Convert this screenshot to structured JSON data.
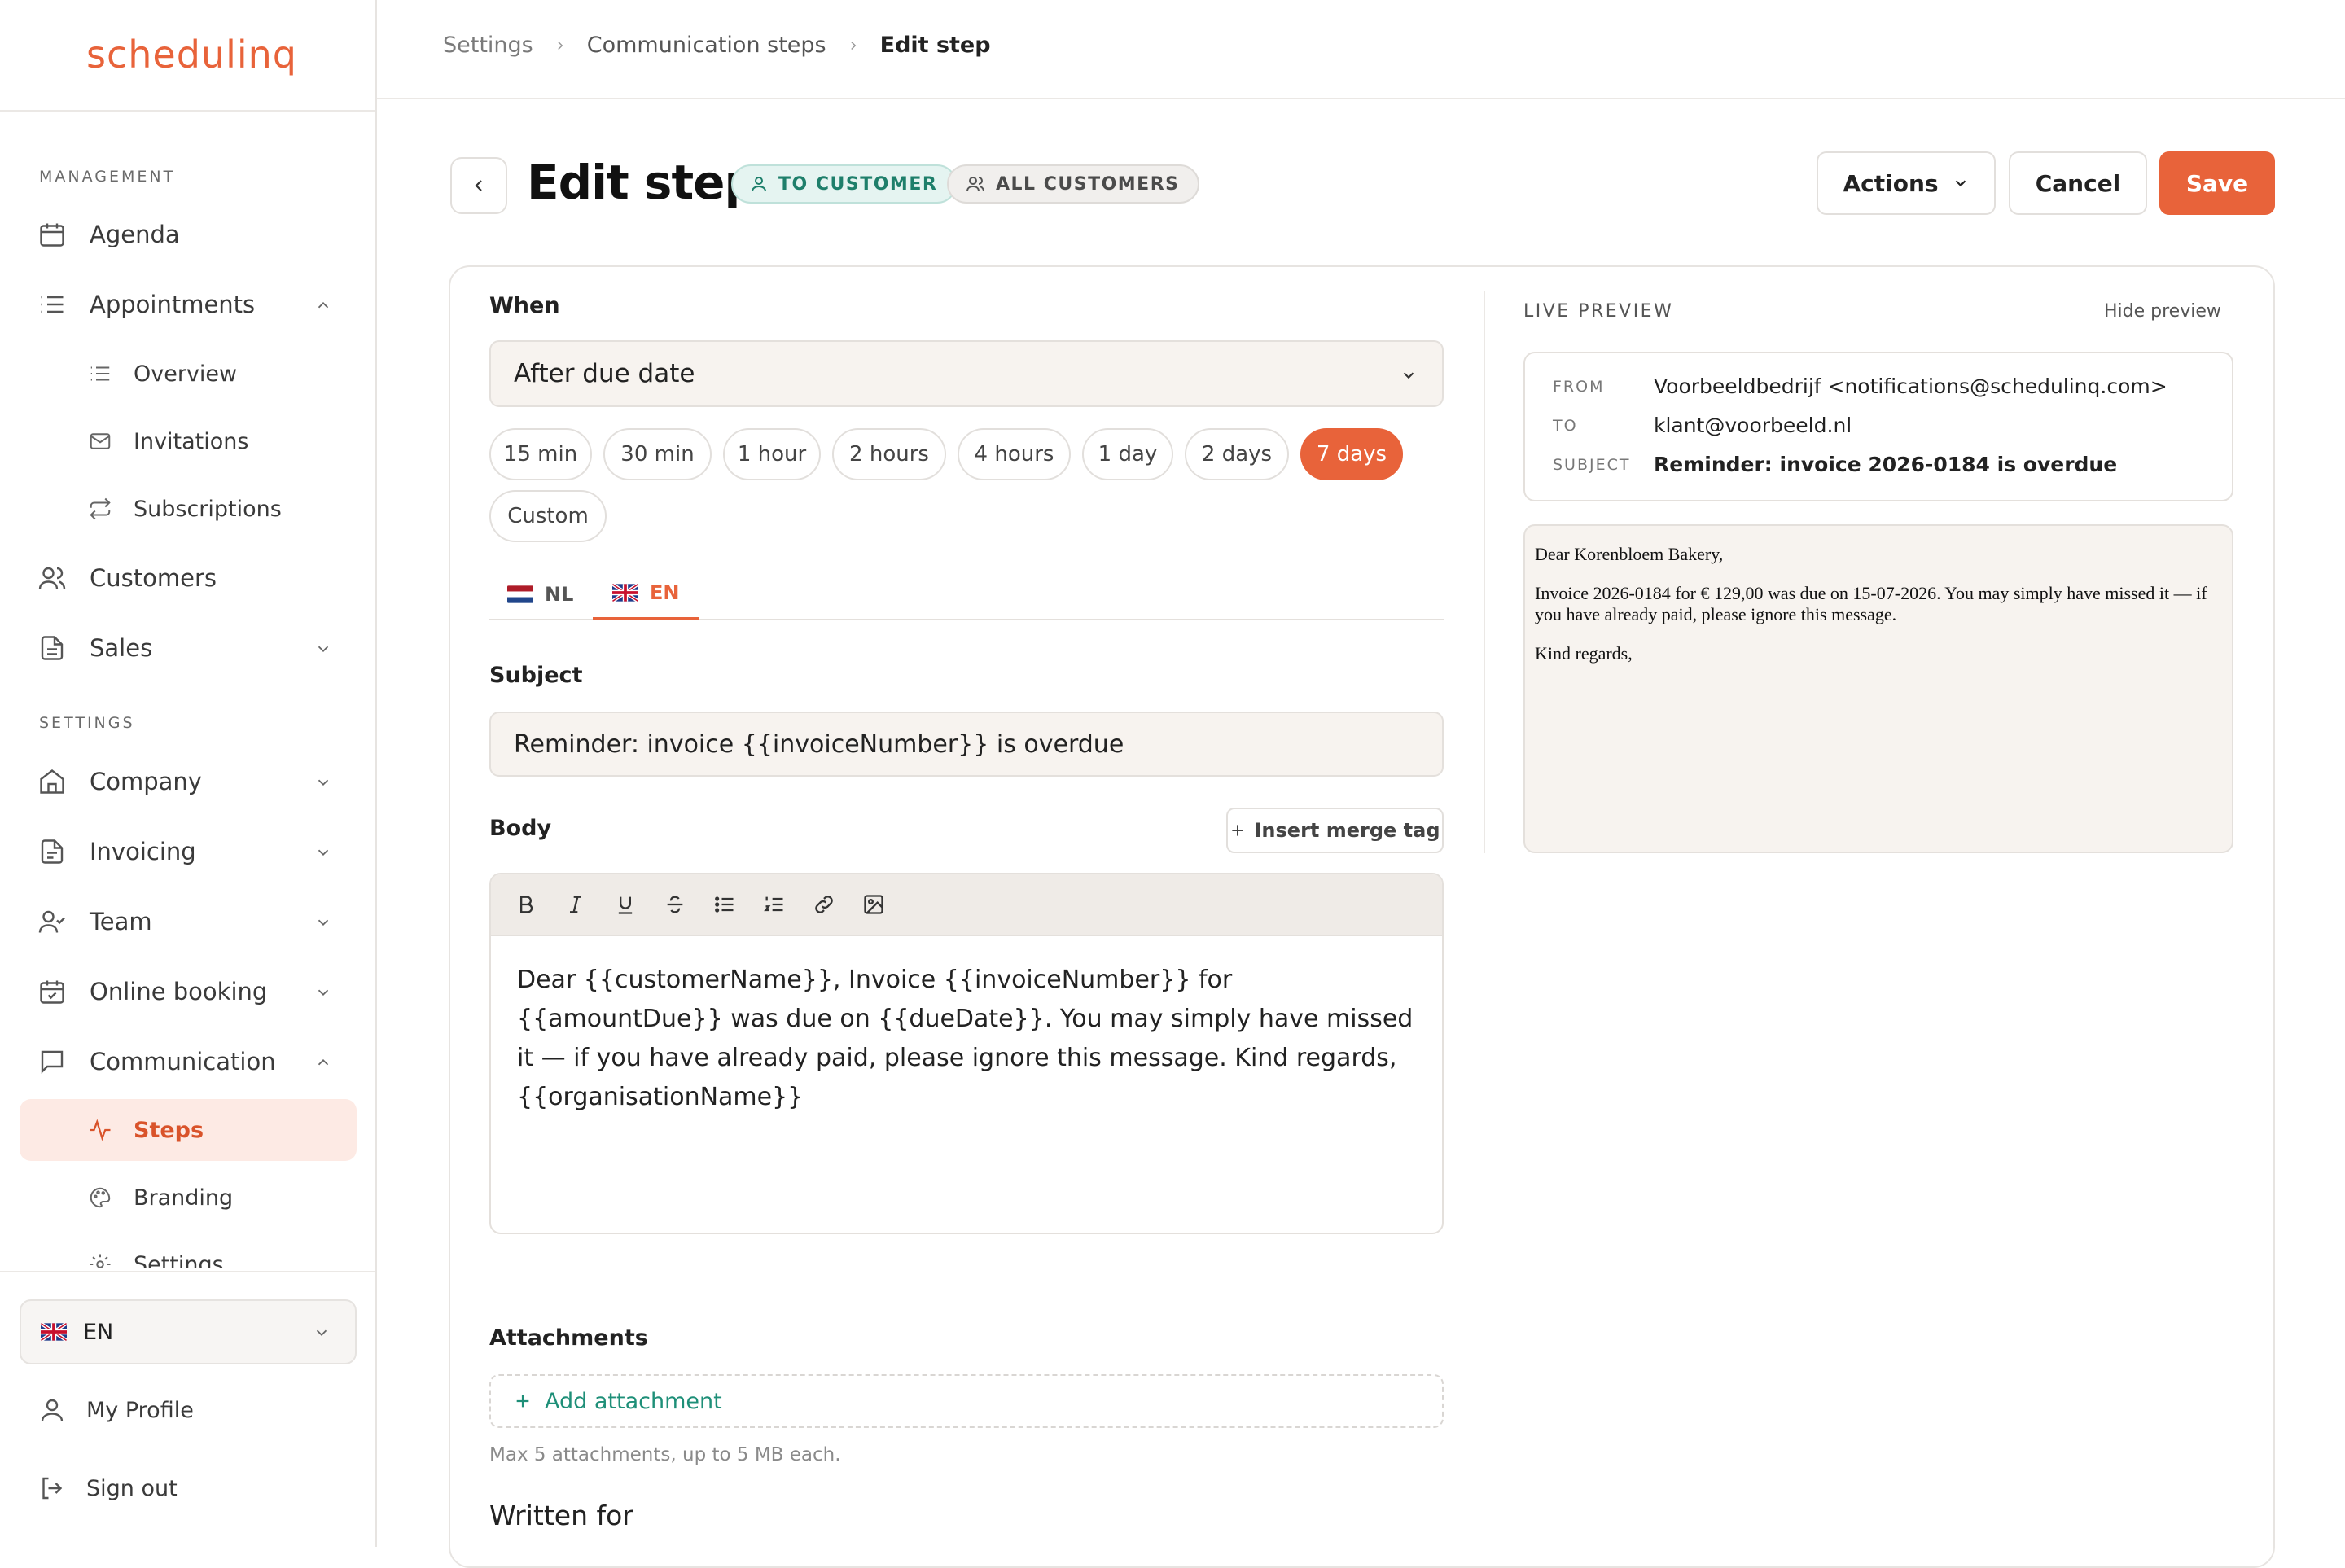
{
  "brand": {
    "logo_text": "schedulinq",
    "accent": "#e8633a"
  },
  "sidebar": {
    "management_label": "MANAGEMENT",
    "settings_label": "SETTINGS",
    "items": {
      "agenda": "Agenda",
      "appointments": "Appointments",
      "overview": "Overview",
      "invitations": "Invitations",
      "subscriptions": "Subscriptions",
      "customers": "Customers",
      "sales": "Sales",
      "company": "Company",
      "invoicing": "Invoicing",
      "team": "Team",
      "online_booking": "Online booking",
      "communication": "Communication",
      "steps": "Steps",
      "branding": "Branding",
      "settings": "Settings"
    },
    "language": "EN",
    "my_profile": "My Profile",
    "sign_out": "Sign out"
  },
  "breadcrumb": [
    "Settings",
    "Communication steps",
    "Edit step"
  ],
  "header": {
    "title": "Edit step",
    "badge_customer": "TO CUSTOMER",
    "badge_all": "ALL CUSTOMERS",
    "actions": "Actions",
    "cancel": "Cancel",
    "save": "Save"
  },
  "form": {
    "when_label": "When",
    "when_value": "After due date",
    "timing_chips": [
      "15 min",
      "30 min",
      "1 hour",
      "2 hours",
      "4 hours",
      "1 day",
      "2 days",
      "7 days"
    ],
    "selected_chip": "7 days",
    "custom_chip": "Custom",
    "lang_tabs": [
      "NL",
      "EN"
    ],
    "active_lang": "EN",
    "subject_label": "Subject",
    "subject_value": "Reminder: invoice {{invoiceNumber}} is overdue",
    "body_label": "Body",
    "insert_merge_tag": "Insert merge tag",
    "body_text": "Dear {{customerName}}, Invoice {{invoiceNumber}} for {{amountDue}} was due on {{dueDate}}. You may simply have missed it — if you have already paid, please ignore this message. Kind regards, {{organisationName}}",
    "attachments_label": "Attachments",
    "add_attachment": "Add attachment",
    "attachments_hint": "Max 5 attachments, up to 5 MB each.",
    "written_for": "Written for"
  },
  "preview": {
    "label": "LIVE PREVIEW",
    "hide": "Hide preview",
    "from_label": "FROM",
    "from_value": "Voorbeeldbedrijf <notifications@schedulinq.com>",
    "to_label": "TO",
    "to_value": "klant@voorbeeld.nl",
    "subject_label": "SUBJECT",
    "subject_value": "Reminder: invoice 2026-0184 is overdue",
    "greeting": "Dear Korenbloem Bakery,",
    "paragraph": "Invoice 2026-0184 for € 129,00 was due on 15-07-2026. You may simply have missed it — if you have already paid, please ignore this message.",
    "closing": "Kind regards,"
  }
}
